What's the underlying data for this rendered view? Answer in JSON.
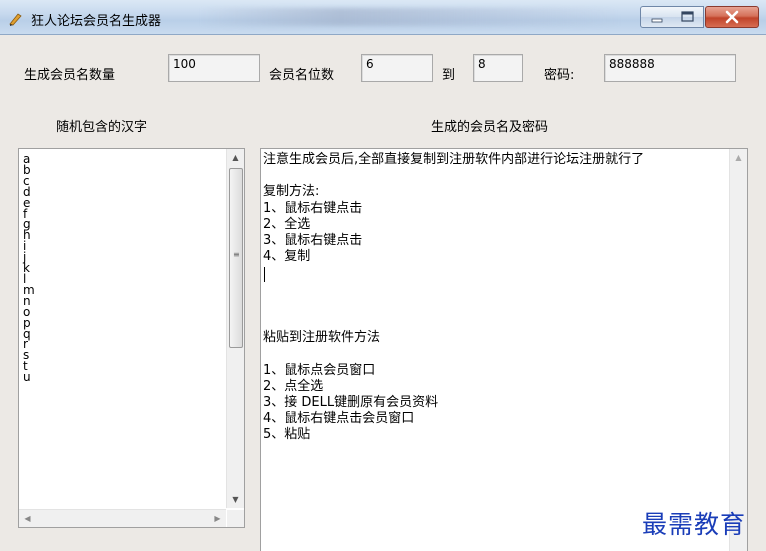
{
  "window": {
    "title": "狂人论坛会员名生成器"
  },
  "form": {
    "count_label": "生成会员名数量",
    "count_value": "100",
    "digits_label": "会员名位数",
    "digits_from": "6",
    "to_label": "到",
    "digits_to": "8",
    "password_label": "密码:",
    "password_value": "888888"
  },
  "left_panel": {
    "header": "随机包含的汉字",
    "items": [
      "a",
      "b",
      "c",
      "d",
      "e",
      "f",
      "g",
      "h",
      "i",
      "j",
      "k",
      "l",
      "m",
      "n",
      "o",
      "p",
      "q",
      "r",
      "s",
      "t",
      "u"
    ]
  },
  "right_panel": {
    "header": "生成的会员名及密码",
    "lines": [
      "注意生成会员后,全部直接复制到注册软件内部进行论坛注册就行了",
      "",
      "复制方法:",
      "1、鼠标右键点击",
      "2、全选",
      "3、鼠标右键点击",
      "4、复制",
      "",
      "",
      "",
      "",
      "粘贴到注册软件方法",
      "",
      "1、鼠标点会员窗口",
      "2、点全选",
      "3、接 DELL键删原有会员资料",
      "4、鼠标右键点击会员窗口",
      "5、粘贴"
    ]
  },
  "watermark": "最需教育",
  "icons": {
    "app": "pen-icon",
    "minimize": "minimize-icon",
    "maximize": "maximize-icon",
    "close": "close-icon"
  }
}
